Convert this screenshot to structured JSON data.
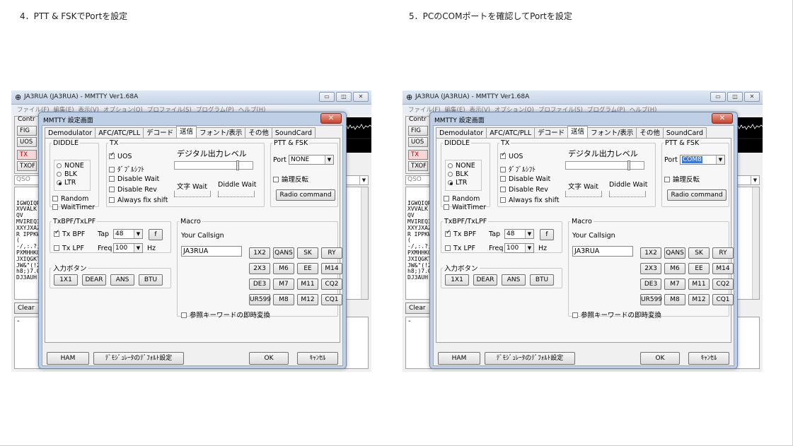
{
  "captions": {
    "left": "4．PTT & FSKでPortを設定",
    "right": "5．PCのCOMポートを確認してPortを設定"
  },
  "main_window": {
    "title": "JA3RUA (JA3RUA) - MMTTY Ver1.68A",
    "menu": [
      "ファイル(F)",
      "編集(E)",
      "表示(V)",
      "オプション(O)",
      "プロファイル(S)",
      "プログラム(P)",
      "ヘルプ(H)"
    ],
    "control_label": "Contr",
    "side_buttons": [
      "FIG",
      "UOS",
      "TX",
      "TXOF"
    ],
    "qso_label": "QSO",
    "rx_lines": [
      "IGWQIQR",
      "XVVALK",
      "QV",
      "MVIREQI",
      "XXYJXAZ",
      "R IPPKW",
      "(",
      "-/,:.?;",
      "PXMHHKO",
      "JXIQGKT",
      "JW&\"(!2",
      "h8;)7.G",
      "DJ3AUH"
    ],
    "clear_label": "Clear",
    "tx_text": "-"
  },
  "dialog": {
    "title": "MMTTY 設定画面",
    "close_glyph": "✕",
    "tabs": [
      "Demodulator",
      "AFC/ATC/PLL",
      "デコード",
      "送信",
      "フォント/表示",
      "その他",
      "SoundCard"
    ],
    "diddle": {
      "legend": "DIDDLE",
      "options": [
        "NONE",
        "BLK",
        "LTR"
      ],
      "random": "Random",
      "waittimer": "WaitTimer"
    },
    "tx": {
      "legend": "TX",
      "options": [
        "UOS",
        "ﾀﾞﾌﾞﾙｼﾌﾄ",
        "Disable Wait",
        "Disable Rev",
        "Always fix shift"
      ],
      "level_label": "デジタル出力レベル",
      "char_wait": "文字 Wait",
      "diddle_wait": "Diddle Wait"
    },
    "ptt": {
      "legend": "PTT & FSK",
      "port_label": "Port",
      "invert": "論理反転",
      "radio_command": "Radio command"
    },
    "txbpf": {
      "legend": "TxBPF/TxLPF",
      "bpf": "Tx BPF",
      "tap_label": "Tap",
      "tap_value": "48",
      "f_button": "f",
      "lpf": "Tx LPF",
      "freq_label": "Freq",
      "freq_value": "100",
      "hz": "Hz"
    },
    "input_buttons": {
      "legend": "入力ボタン",
      "buttons": [
        "1X1",
        "DEAR",
        "ANS",
        "BTU"
      ]
    },
    "macro": {
      "legend": "Macro",
      "callsign_label": "Your Callsign",
      "callsign_value": "JA3RUA",
      "rows": [
        [
          "1X2",
          "QANS",
          "SK",
          "RY"
        ],
        [
          "2X3",
          "M6",
          "EE",
          "M14"
        ],
        [
          "DE3",
          "M7",
          "M11",
          "CQ2"
        ],
        [
          "UR599",
          "M8",
          "M12",
          "CQ1"
        ]
      ],
      "keyword": "参照キーワードの即時変換"
    },
    "footer": {
      "ham": "HAM",
      "default": "ﾃﾞﾓｼﾞｭﾚｰﾀのﾃﾞﾌｫﾙﾄ設定",
      "ok": "OK",
      "cancel": "ｷｬﾝｾﾙ"
    }
  },
  "ports": {
    "left": "NONE",
    "right": "COM8"
  },
  "sliders": {
    "output_level": 0.82
  }
}
